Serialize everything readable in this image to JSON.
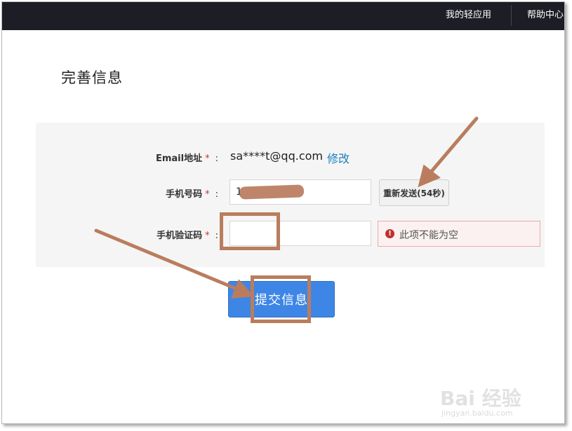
{
  "nav": {
    "my_apps": "我的轻应用",
    "help_center": "帮助中心"
  },
  "page": {
    "title": "完善信息"
  },
  "form": {
    "email_label": "Email地址",
    "email_value": "sa****t@qq.com",
    "modify_link": "修改",
    "phone_label": "手机号码",
    "phone_value": "1",
    "resend_button": "重新发送(54秒)",
    "code_label": "手机验证码",
    "code_value": "",
    "error_message": "此项不能为空",
    "required_mark": "*",
    "colon": ":"
  },
  "submit": {
    "label": "提交信息"
  },
  "watermark": {
    "logo": "Bai 经验",
    "url": "jingyan.baidu.com"
  },
  "colors": {
    "topbar": "#1d1d26",
    "submit": "#3e86e6",
    "link": "#1a7ec0",
    "annotation": "#b97d5e",
    "error": "#c03030"
  }
}
